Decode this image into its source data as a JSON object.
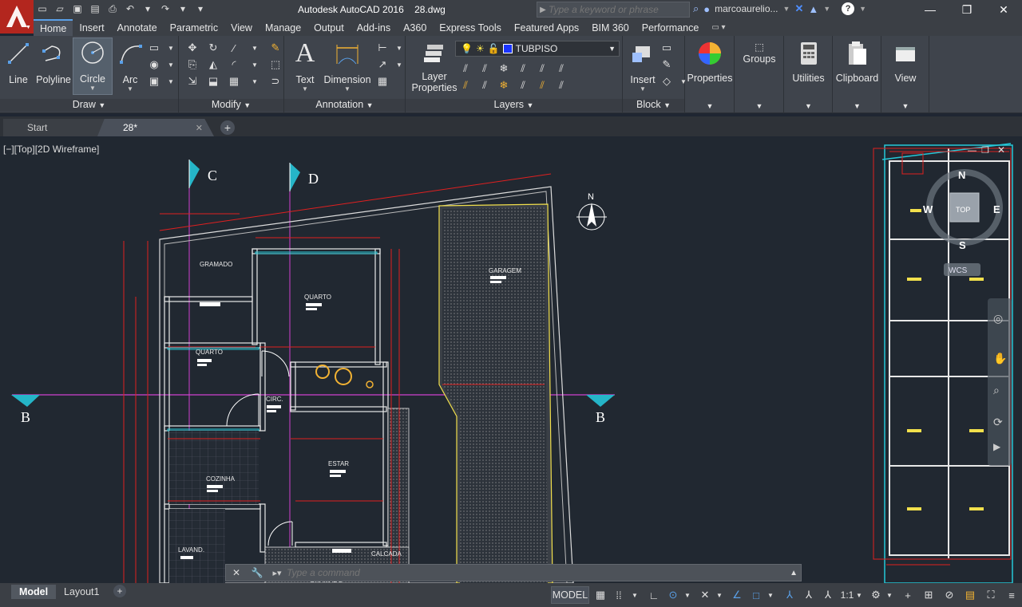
{
  "window": {
    "app_title": "Autodesk AutoCAD 2016",
    "document": "28.dwg",
    "search_placeholder": "Type a keyword or phrase",
    "user": "marcoaurelio...",
    "minimize": "—",
    "restore": "❐",
    "close": "✕"
  },
  "menu_tabs": [
    "Home",
    "Insert",
    "Annotate",
    "Parametric",
    "View",
    "Manage",
    "Output",
    "Add-ins",
    "A360",
    "Express Tools",
    "Featured Apps",
    "BIM 360",
    "Performance"
  ],
  "ribbon": {
    "draw": {
      "label": "Draw",
      "tools": [
        "Line",
        "Polyline",
        "Circle",
        "Arc"
      ]
    },
    "modify": {
      "label": "Modify"
    },
    "annotation": {
      "label": "Annotation",
      "tools": [
        "Text",
        "Dimension"
      ]
    },
    "layers": {
      "label": "Layers",
      "tool": "Layer\nProperties",
      "tool_line1": "Layer",
      "tool_line2": "Properties",
      "current_layer": "TUBPISO",
      "layer_color": "#1a34ff"
    },
    "block": {
      "label": "Block",
      "tool": "Insert"
    },
    "properties": {
      "label": "Properties"
    },
    "groups": {
      "label": "Groups"
    },
    "utilities": {
      "label": "Utilities"
    },
    "clipboard": {
      "label": "Clipboard"
    },
    "view": {
      "label": "View"
    }
  },
  "doc_tabs": [
    {
      "label": "Start"
    },
    {
      "label": "28*"
    }
  ],
  "viewport": {
    "label": "[−][Top][2D Wireframe]",
    "section_markers": [
      "C",
      "D",
      "B",
      "B"
    ],
    "north": "N",
    "rooms": [
      "GRAMADO",
      "QUARTO",
      "QUARTO",
      "CIRC.",
      "COZINHA",
      "ESTAR",
      "GARAGEM",
      "LAVAND.",
      "CALCADA",
      "GRAMADO"
    ],
    "viewcube": {
      "top": "TOP",
      "n": "N",
      "s": "S",
      "e": "E",
      "w": "W",
      "wcs": "WCS"
    }
  },
  "command_placeholder": "Type a command",
  "status": {
    "layout_tabs": [
      "Model",
      "Layout1"
    ],
    "model_label": "MODEL",
    "scale": "1:1"
  }
}
